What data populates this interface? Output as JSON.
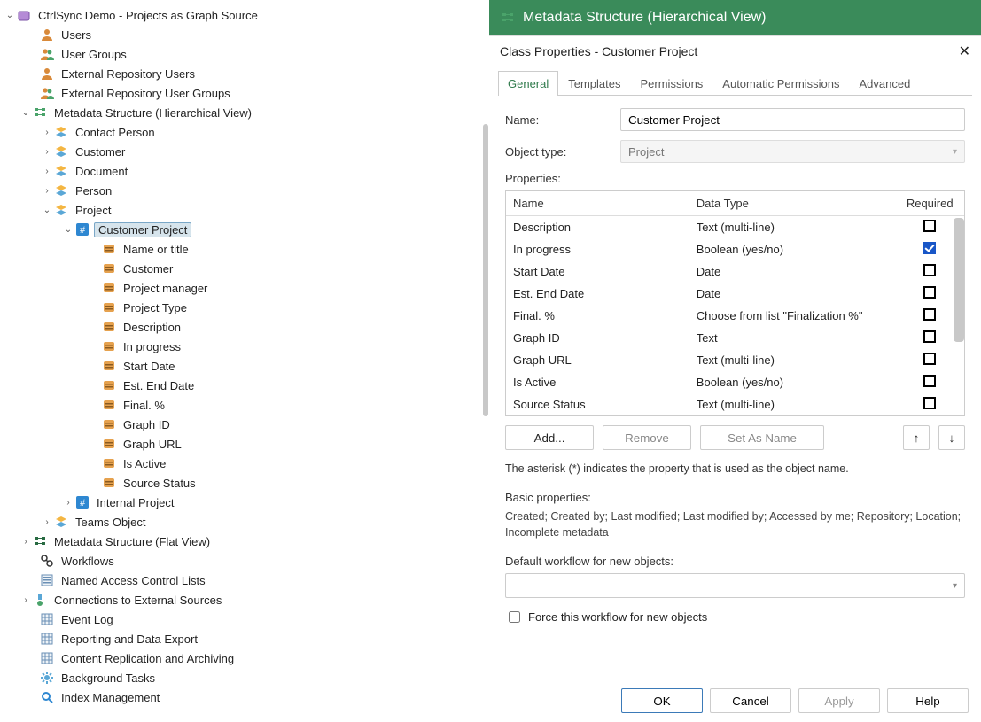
{
  "header": {
    "title": "Metadata Structure (Hierarchical View)"
  },
  "tree": {
    "root": "CtrlSync Demo - Projects as Graph Source",
    "l1": {
      "users": "Users",
      "user_groups": "User Groups",
      "ext_users": "External Repository Users",
      "ext_groups": "External Repository User Groups",
      "meta_hier": "Metadata Structure (Hierarchical View)",
      "meta_flat": "Metadata Structure (Flat View)",
      "workflows": "Workflows",
      "nacl": "Named Access Control Lists",
      "conn_ext": "Connections to External Sources",
      "event_log": "Event Log",
      "report": "Reporting and Data Export",
      "replication": "Content Replication and Archiving",
      "bgtasks": "Background Tasks",
      "indexmgmt": "Index Management"
    },
    "meta_children": {
      "contact": "Contact Person",
      "customer": "Customer",
      "document": "Document",
      "person": "Person",
      "project": "Project",
      "teams": "Teams Object"
    },
    "project_children": {
      "cust_proj": "Customer Project",
      "int_proj": "Internal Project"
    },
    "cust_proj_props": [
      "Name or title",
      "Customer",
      "Project manager",
      "Project Type",
      "Description",
      "In progress",
      "Start Date",
      "Est. End Date",
      "Final. %",
      "Graph ID",
      "Graph URL",
      "Is Active",
      "Source Status"
    ]
  },
  "dialog": {
    "title": "Class Properties - Customer Project",
    "tabs": [
      "General",
      "Templates",
      "Permissions",
      "Automatic Permissions",
      "Advanced"
    ],
    "labels": {
      "name": "Name:",
      "object_type": "Object type:",
      "properties": "Properties:",
      "basic_header": "Basic properties:",
      "default_wf": "Default workflow for new objects:",
      "force_wf": "Force this workflow for new objects"
    },
    "name_value": "Customer Project",
    "object_type_value": "Project",
    "columns": {
      "name": "Name",
      "datatype": "Data Type",
      "required": "Required"
    },
    "properties_rows": [
      {
        "name": "Description",
        "dt": "Text (multi-line)",
        "req": false
      },
      {
        "name": "In progress",
        "dt": "Boolean (yes/no)",
        "req": true
      },
      {
        "name": "Start Date",
        "dt": "Date",
        "req": false
      },
      {
        "name": "Est. End Date",
        "dt": "Date",
        "req": false
      },
      {
        "name": "Final. %",
        "dt": "Choose from list \"Finalization %\"",
        "req": false
      },
      {
        "name": "Graph ID",
        "dt": "Text",
        "req": false
      },
      {
        "name": "Graph URL",
        "dt": "Text (multi-line)",
        "req": false
      },
      {
        "name": "Is Active",
        "dt": "Boolean (yes/no)",
        "req": false
      },
      {
        "name": "Source Status",
        "dt": "Text (multi-line)",
        "req": false
      }
    ],
    "buttons": {
      "add": "Add...",
      "remove": "Remove",
      "setname": "Set As Name"
    },
    "note": "The asterisk (*) indicates the property that is used as the object name.",
    "basic_text": "Created; Created by; Last modified; Last modified by; Accessed by me; Repository; Location; Incomplete metadata",
    "footer": {
      "ok": "OK",
      "cancel": "Cancel",
      "apply": "Apply",
      "help": "Help"
    }
  }
}
